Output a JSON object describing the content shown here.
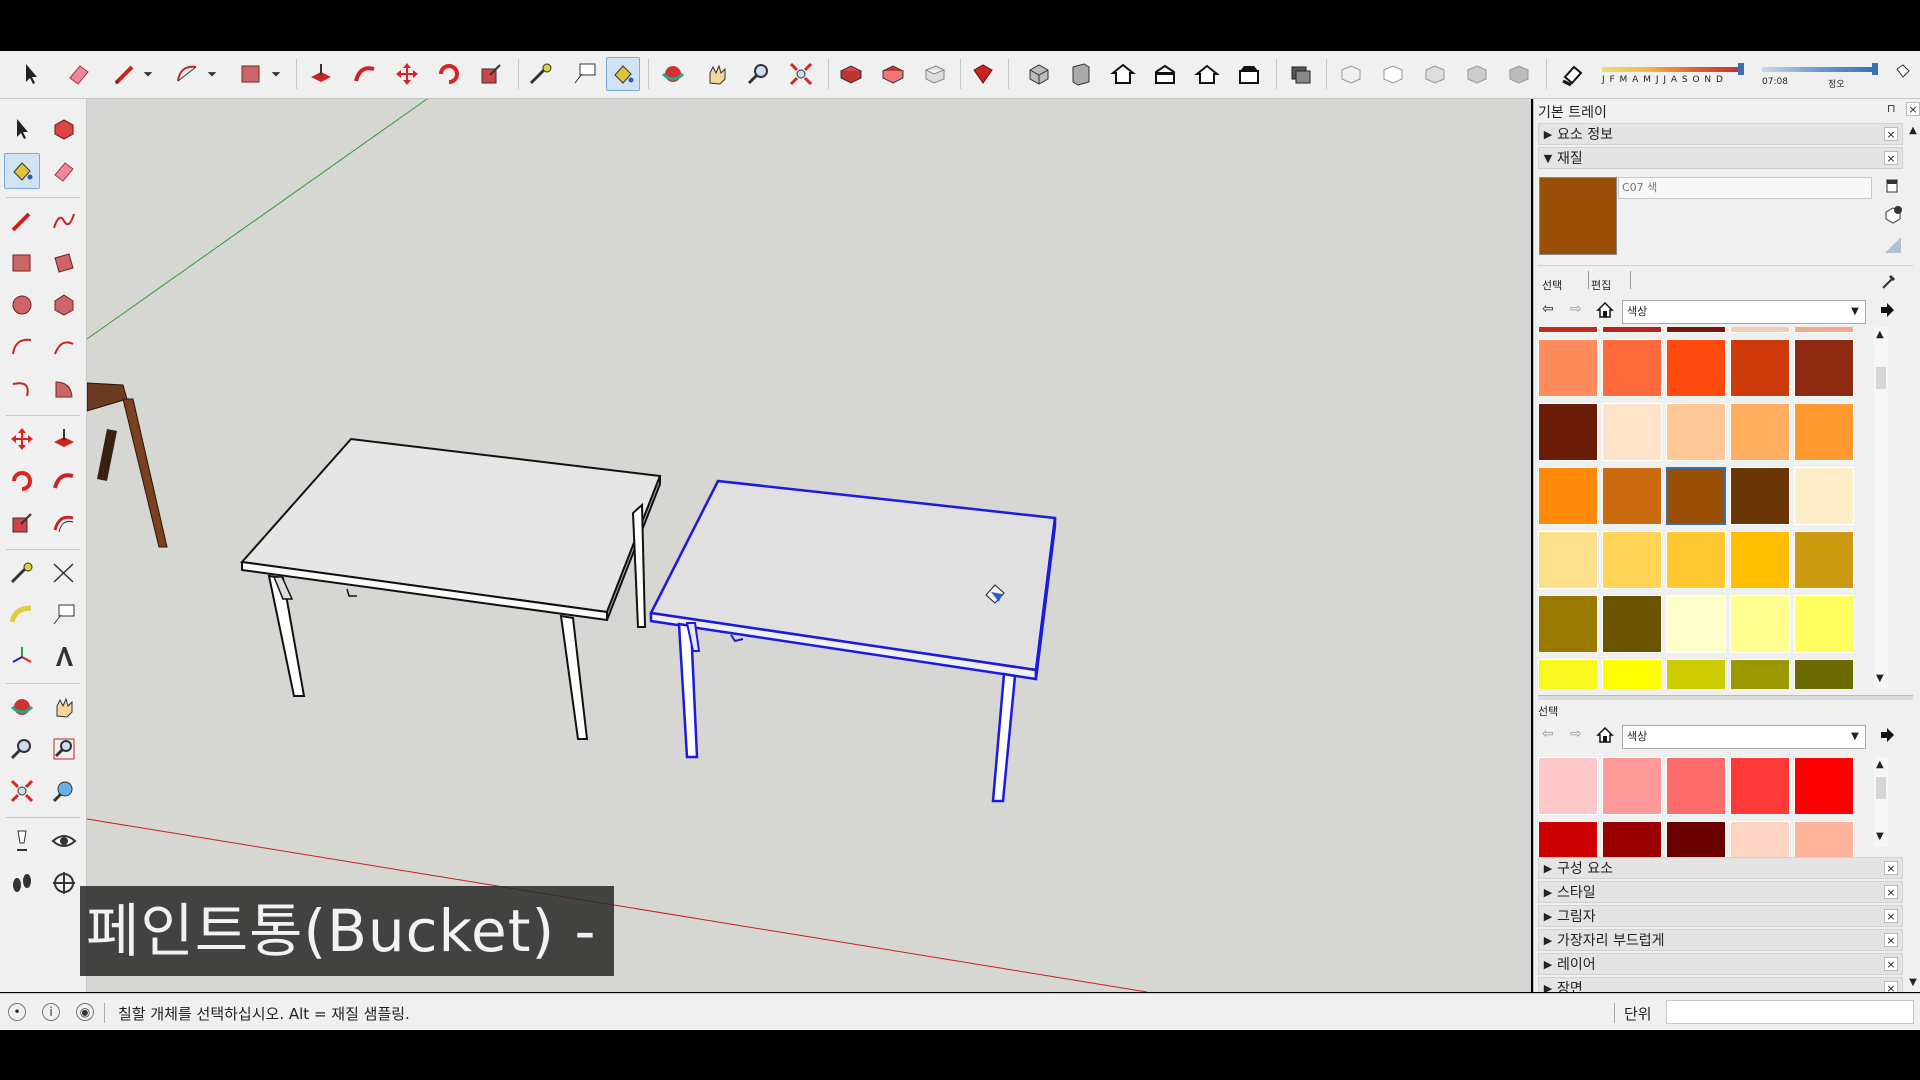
{
  "toolbar": {
    "month_ticks": "J F M A M J J A S O N D",
    "time": "07:08",
    "noon": "정오"
  },
  "caption": "페인트통(Bucket) - B",
  "tray": {
    "title": "기본 트레이",
    "pin_glyph": "⊓",
    "close_glyph": "×",
    "entity_info": "요소 정보",
    "materials": "재질",
    "material_name": "C07 색",
    "material_color": "#9a4f07",
    "tab_select": "선택",
    "tab_edit": "편집",
    "collection": "색상",
    "swatches_top": [
      "#c52a1a",
      "#b9231a",
      "#7a1510",
      "#f4cbb8",
      "#f2a98c",
      "#ff8a5c",
      "#ff6a3a",
      "#ff4a10",
      "#cc3a0a",
      "#8e2a10",
      "#6b1d0a",
      "#ffe4cc",
      "#ffc896",
      "#ffae60",
      "#ff9a30",
      "#ff8a0a",
      "#cc6a10",
      "#9a4f07",
      "#6b3606",
      "#ffefc8",
      "#ffe08a",
      "#ffd456",
      "#ffc830",
      "#ffbe00",
      "#cc9a10",
      "#9a7a00",
      "#6b5400",
      "#ffffcc",
      "#ffff90",
      "#ffff60",
      "#f8f820",
      "#ffff00",
      "#cccc00",
      "#9a9a00",
      "#6b6b00"
    ],
    "secondary_label": "선택",
    "secondary_collection": "색상",
    "swatches_bottom": [
      "#ffc8c8",
      "#ff9a9a",
      "#ff6a6a",
      "#ff3838",
      "#ff0000",
      "#cc0000",
      "#9a0000",
      "#6b0000",
      "#ffd4c4",
      "#ffb49a"
    ],
    "panels": [
      "구성 요소",
      "스타일",
      "그림자",
      "가장자리 부드럽게",
      "레이어",
      "장면"
    ]
  },
  "status": {
    "message": "칠할 개체를 선택하십시오. Alt = 재질 샘플링.",
    "units_label": "단위",
    "units_value": ""
  }
}
